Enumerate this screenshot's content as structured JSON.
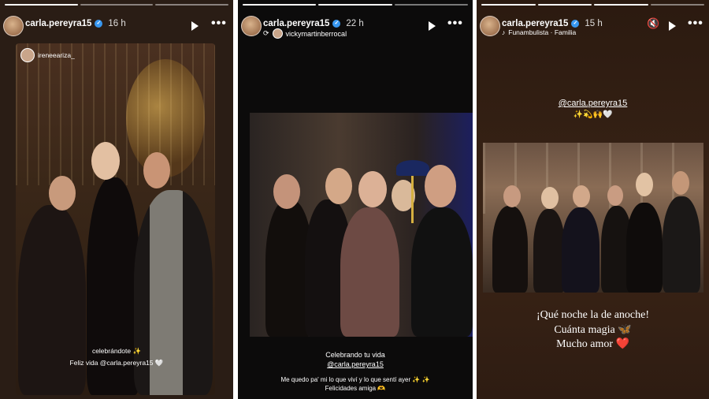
{
  "stories": [
    {
      "username": "carla.pereyra15",
      "time": "16 h",
      "tag": "ireneeariza_",
      "caption_line1": "celebrándote ✨",
      "caption_line2": "Feliz vida @carla.pereyra15 🤍",
      "icons": [
        "play-icon",
        "more-icon"
      ]
    },
    {
      "username": "carla.pereyra15",
      "time": "22 h",
      "repost_from": "vickymartinberrocal",
      "caption_line1": "Celebrando tu vida",
      "caption_line2": "@carla.pereyra15",
      "caption_line3": "Me quedo pa' mi lo que viví y lo que sentí ayer ✨ ✨",
      "caption_line4": "Felicidades amiga 🫶",
      "icons": [
        "repost-icon",
        "play-icon",
        "more-icon"
      ]
    },
    {
      "username": "carla.pereyra15",
      "time": "15 h",
      "music": "Funambulista · Familia",
      "mention": "@carla.pereyra15",
      "emoji_line": "✨💫🙌🤍",
      "text_line1": "¡Qué noche la de anoche!",
      "text_line2": "Cuánta magia 🦋",
      "text_line3": "Mucho amor ❤️",
      "icons": [
        "mute-icon",
        "play-icon",
        "more-icon"
      ]
    }
  ]
}
